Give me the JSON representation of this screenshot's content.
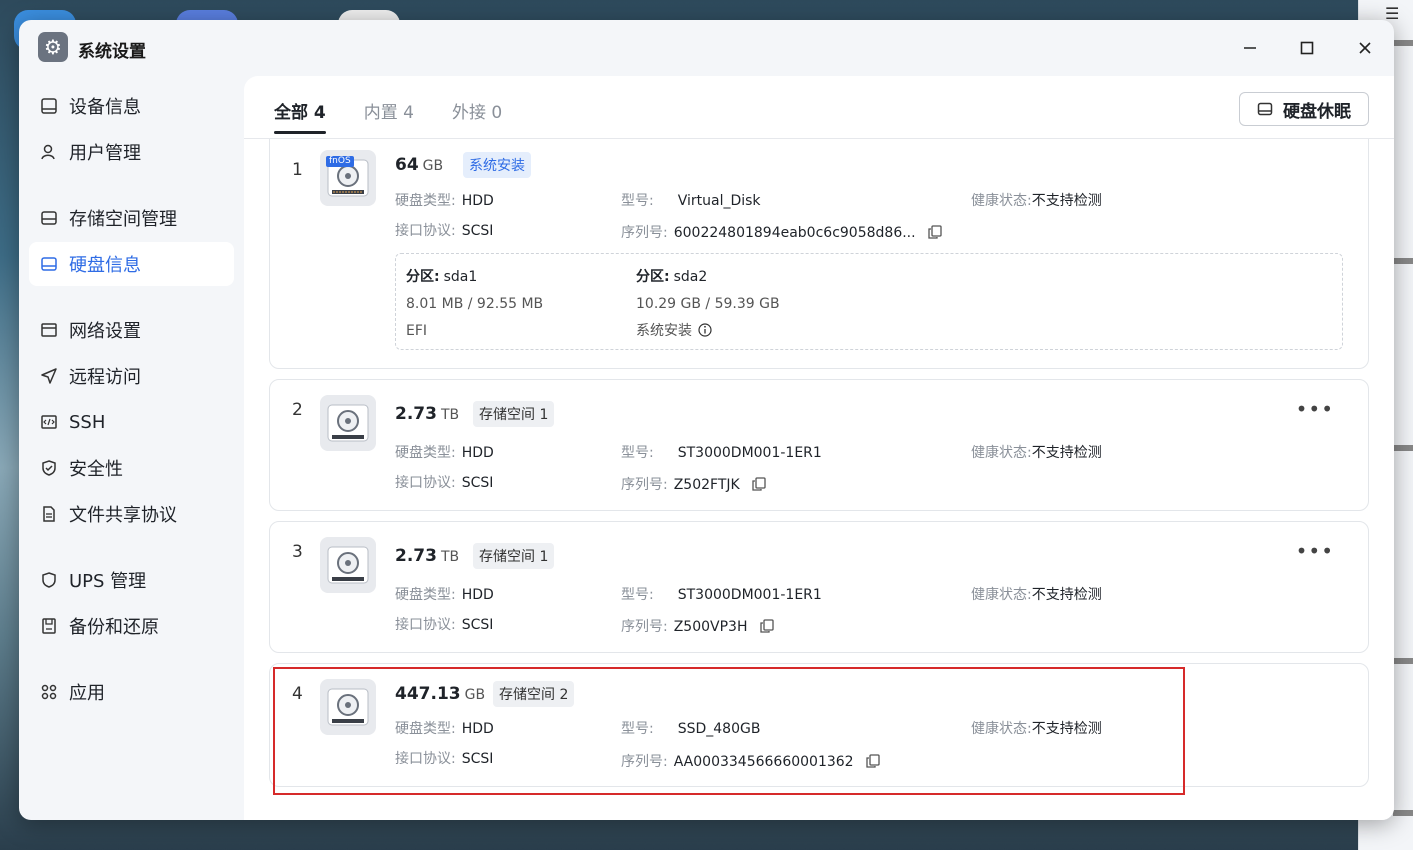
{
  "window": {
    "title": "系统设置",
    "controls": [
      "minimize",
      "maximize",
      "close"
    ]
  },
  "sidebar": {
    "items": [
      {
        "label": "设备信息",
        "icon": "device-icon"
      },
      {
        "label": "用户管理",
        "icon": "user-icon"
      },
      {
        "label": "存储空间管理",
        "icon": "storage-icon"
      },
      {
        "label": "硬盘信息",
        "icon": "disk-icon",
        "active": true
      },
      {
        "label": "网络设置",
        "icon": "network-icon"
      },
      {
        "label": "远程访问",
        "icon": "send-icon"
      },
      {
        "label": "SSH",
        "icon": "ssh-icon"
      },
      {
        "label": "安全性",
        "icon": "shield-icon"
      },
      {
        "label": "文件共享协议",
        "icon": "file-icon"
      },
      {
        "label": "UPS 管理",
        "icon": "ups-icon"
      },
      {
        "label": "备份和还原",
        "icon": "backup-icon"
      },
      {
        "label": "应用",
        "icon": "apps-icon"
      }
    ]
  },
  "tabs": [
    {
      "label": "全部 4",
      "active": true
    },
    {
      "label": "内置 4"
    },
    {
      "label": "外接 0"
    }
  ],
  "sleep_button": "硬盘休眠",
  "labels": {
    "disk_type": "硬盘类型:",
    "protocol": "接口协议:",
    "model": "型号:",
    "serial": "序列号:",
    "health": "健康状态:",
    "partition": "分区:"
  },
  "disks": [
    {
      "num": "1",
      "capacity": "64",
      "unit": "GB",
      "badge": "系统安装",
      "fnos": "fnOS",
      "type": "HDD",
      "protocol": "SCSI",
      "model": "Virtual_Disk",
      "serial": "600224801894eab0c6c9058d86...",
      "health": "不支持检测",
      "partitions": [
        {
          "name": "sda1",
          "usage": "8.01 MB / 92.55 MB",
          "fs": "EFI"
        },
        {
          "name": "sda2",
          "usage": "10.29 GB / 59.39 GB",
          "fs": "系统安装"
        }
      ]
    },
    {
      "num": "2",
      "capacity": "2.73",
      "unit": "TB",
      "badge": "存储空间 1",
      "type": "HDD",
      "protocol": "SCSI",
      "model": "ST3000DM001-1ER1",
      "serial": "Z502FTJK",
      "health": "不支持检测"
    },
    {
      "num": "3",
      "capacity": "2.73",
      "unit": "TB",
      "badge": "存储空间 1",
      "type": "HDD",
      "protocol": "SCSI",
      "model": "ST3000DM001-1ER1",
      "serial": "Z500VP3H",
      "health": "不支持检测"
    },
    {
      "num": "4",
      "capacity": "447.13",
      "unit": "GB",
      "badge": "存储空间 2",
      "type": "HDD",
      "protocol": "SCSI",
      "model": "SSD_480GB",
      "serial": "AA000334566660001362",
      "health": "不支持检测"
    }
  ],
  "colors": {
    "accent": "#2f6ce5",
    "highlight_border": "#d62a2a"
  }
}
